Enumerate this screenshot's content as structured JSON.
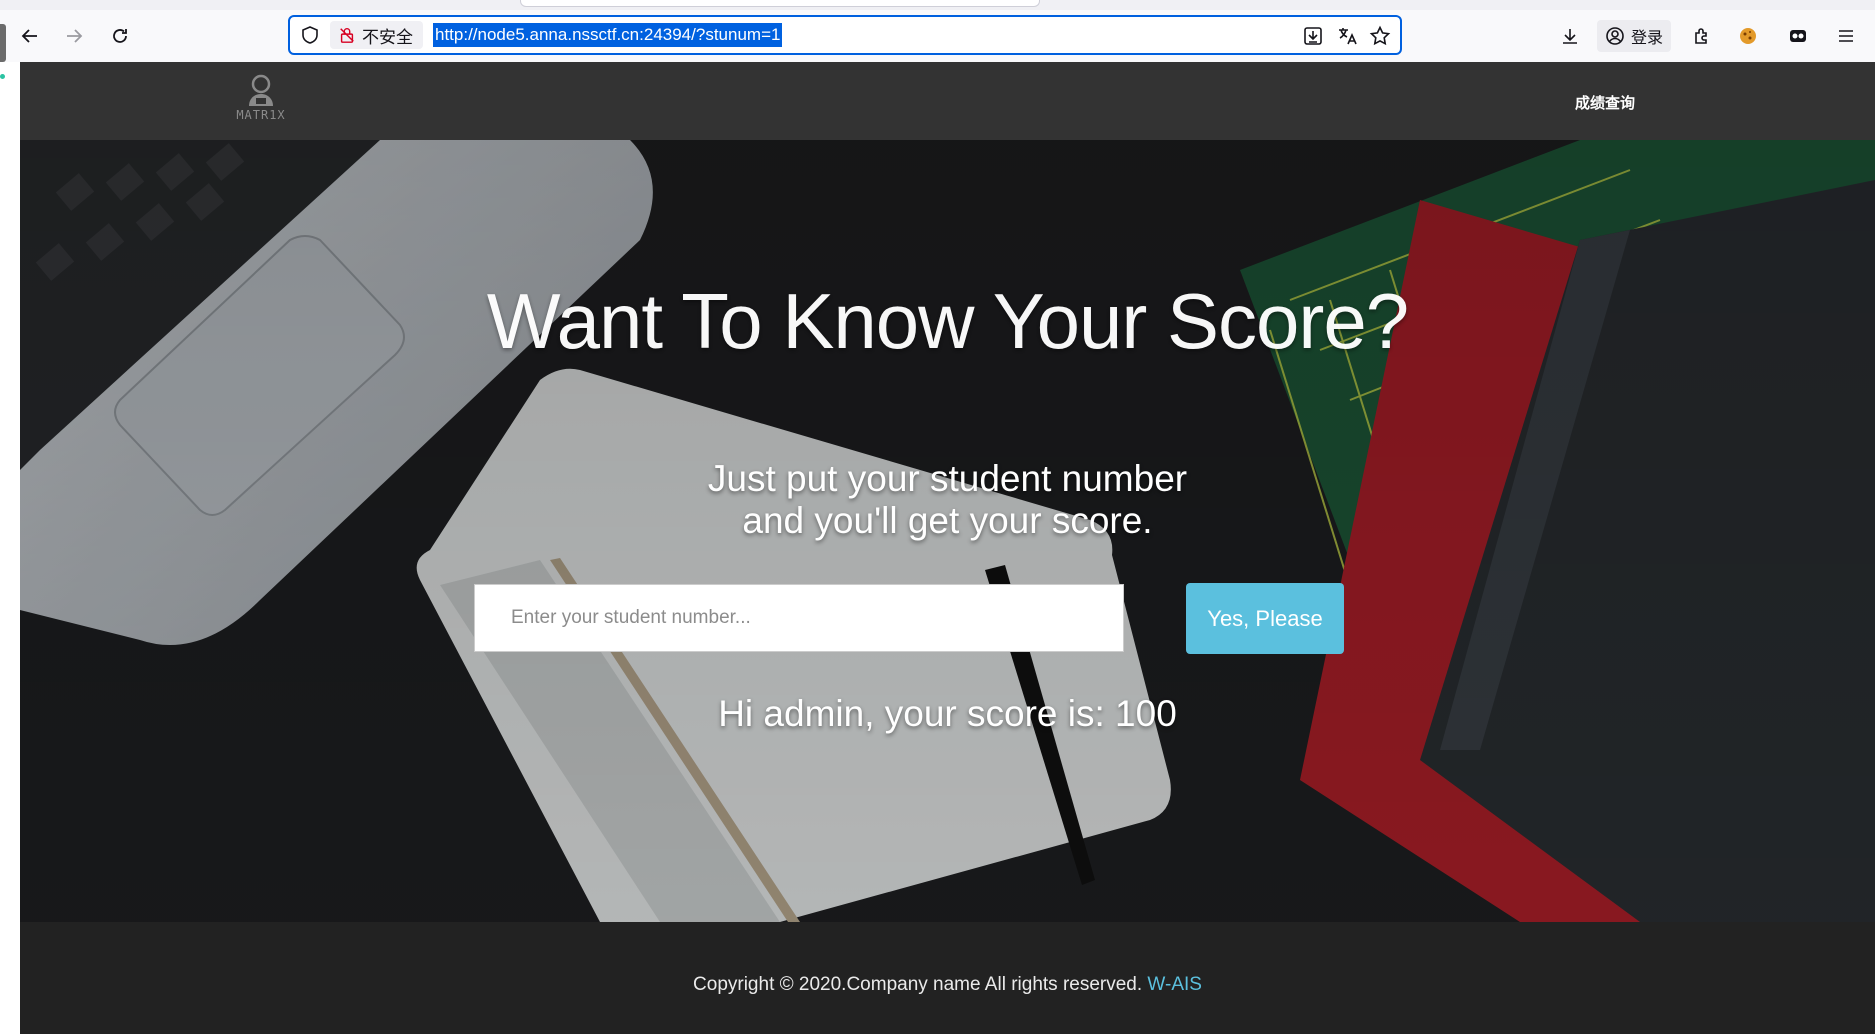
{
  "browser": {
    "security_label": "不安全",
    "url": "http://node5.anna.nssctf.cn:24394/?stunum=1",
    "login_label": "登录"
  },
  "site": {
    "logo_text": "MATR1X",
    "nav_link": "成绩查询"
  },
  "hero": {
    "title": "Want To Know Your Score?",
    "subtitle_line1": "Just put your student number",
    "subtitle_line2": "and you'll get your score.",
    "input_placeholder": "Enter your student number...",
    "button_label": "Yes, Please",
    "result": "Hi admin, your score is: 100"
  },
  "footer": {
    "copyright": "Copyright © 2020.Company name All rights reserved.",
    "link_text": "W-AIS"
  },
  "colors": {
    "accent": "#5bc0de",
    "nav_bg": "#333333",
    "footer_bg": "#222222",
    "url_selection": "#0061e0"
  }
}
